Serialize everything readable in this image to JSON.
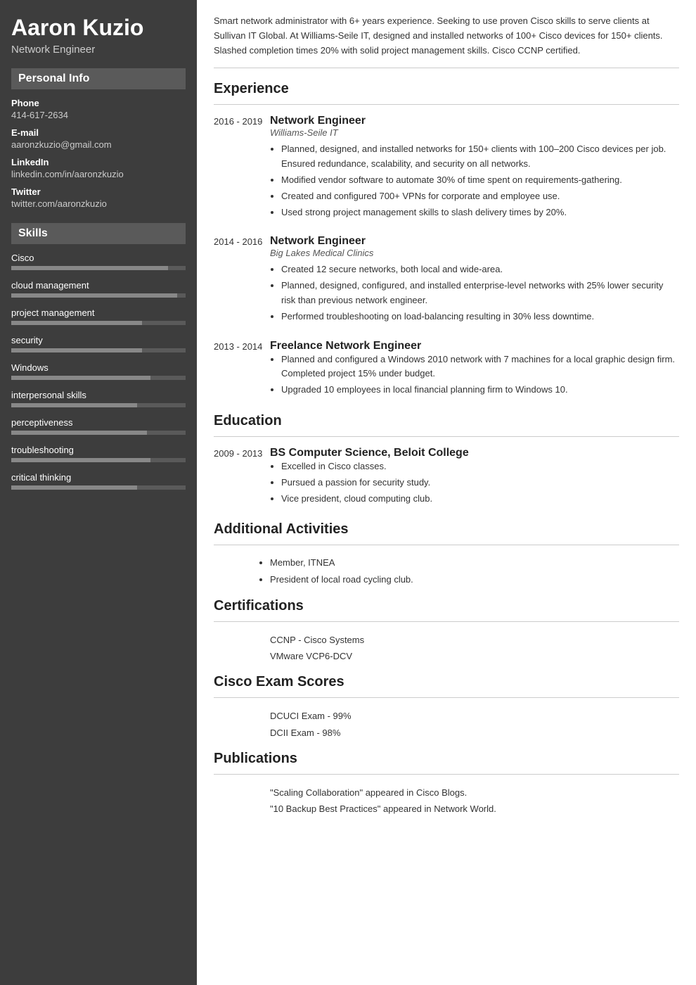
{
  "sidebar": {
    "name": "Aaron Kuzio",
    "title": "Network Engineer",
    "personal_info_header": "Personal Info",
    "phone_label": "Phone",
    "phone_value": "414-617-2634",
    "email_label": "E-mail",
    "email_value": "aaronzkuzio@gmail.com",
    "linkedin_label": "LinkedIn",
    "linkedin_value": "linkedin.com/in/aaronzkuzio",
    "twitter_label": "Twitter",
    "twitter_value": "twitter.com/aaronzkuzio",
    "skills_header": "Skills",
    "skills": [
      {
        "name": "Cisco",
        "pct": 90
      },
      {
        "name": "cloud management",
        "pct": 95
      },
      {
        "name": "project management",
        "pct": 75
      },
      {
        "name": "security",
        "pct": 75
      },
      {
        "name": "Windows",
        "pct": 80
      },
      {
        "name": "interpersonal skills",
        "pct": 72
      },
      {
        "name": "perceptiveness",
        "pct": 78
      },
      {
        "name": "troubleshooting",
        "pct": 80
      },
      {
        "name": "critical thinking",
        "pct": 72
      }
    ]
  },
  "main": {
    "summary": "Smart network administrator with 6+ years experience. Seeking to use proven Cisco skills to serve clients at Sullivan IT Global. At Williams-Seile IT, designed and installed networks of 100+ Cisco devices for 150+ clients. Slashed completion times 20% with solid project management skills. Cisco CCNP certified.",
    "experience_header": "Experience",
    "experience": [
      {
        "dates": "2016 - 2019",
        "title": "Network Engineer",
        "company": "Williams-Seile IT",
        "bullets": [
          "Planned, designed, and installed networks for 150+ clients with 100–200 Cisco devices per job. Ensured redundance, scalability, and security on all networks.",
          "Modified vendor software to automate 30% of time spent on requirements-gathering.",
          "Created and configured 700+ VPNs for corporate and employee use.",
          "Used strong project management skills to slash delivery times by 20%."
        ]
      },
      {
        "dates": "2014 - 2016",
        "title": "Network Engineer",
        "company": "Big Lakes Medical Clinics",
        "bullets": [
          "Created 12 secure networks, both local and wide-area.",
          "Planned, designed, configured, and installed enterprise-level networks with 25% lower security risk than previous network engineer.",
          "Performed troubleshooting on load-balancing resulting in 30% less downtime."
        ]
      },
      {
        "dates": "2013 - 2014",
        "title": "Freelance Network Engineer",
        "company": "",
        "bullets": [
          "Planned and configured a Windows 2010 network with 7 machines for a local graphic design firm. Completed project 15% under budget.",
          "Upgraded 10 employees in local financial planning firm to Windows 10."
        ]
      }
    ],
    "education_header": "Education",
    "education": [
      {
        "dates": "2009 - 2013",
        "degree": "BS Computer Science, Beloit College",
        "bullets": [
          "Excelled in Cisco classes.",
          "Pursued a passion for security study.",
          "Vice president, cloud computing club."
        ]
      }
    ],
    "activities_header": "Additional Activities",
    "activities": [
      "Member, ITNEA",
      "President of local road cycling club."
    ],
    "certifications_header": "Certifications",
    "certifications": [
      "CCNP - Cisco Systems",
      "VMware VCP6-DCV"
    ],
    "exam_scores_header": "Cisco Exam Scores",
    "exam_scores": [
      "DCUCI Exam - 99%",
      "DCII Exam - 98%"
    ],
    "publications_header": "Publications",
    "publications": [
      "\"Scaling Collaboration\" appeared in Cisco Blogs.",
      "\"10 Backup Best Practices\" appeared in Network World."
    ]
  }
}
